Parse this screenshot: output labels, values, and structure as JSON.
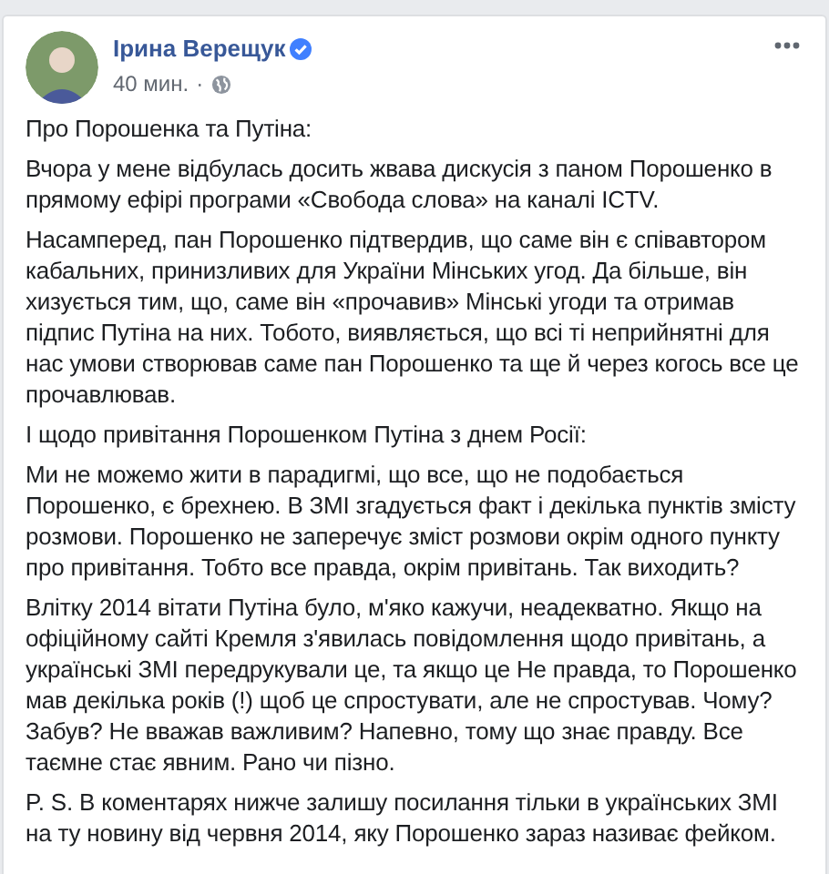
{
  "post": {
    "author": "Ірина Верещук",
    "verified": true,
    "time": "40 мин.",
    "separator": "·",
    "paragraphs": [
      "Про Порошенка та Путіна:",
      "Вчора у мене відбулась досить жвава дискусія з паном Порошенко в прямому ефірі програми «Свобода слова» на каналі ICTV.",
      "Насамперед, пан Порошенко підтвердив, що саме він є співавтором кабальних, принизливих для України Мінських угод. Да більше, він хизується тим, що, саме він «прочавив» Мінські угоди та отримав підпис Путіна на них. Тобото, виявляється, що всі ті неприйнятні для нас умови створював саме пан Порошенко та ще й через когось все це прочавлював.",
      "І щодо привітання Порошенком Путіна з днем Росії:",
      "Ми не можемо жити в парадигмі, що все, що не подобається Порошенко, є брехнею. В ЗМІ згадується факт і декілька пунктів змісту розмови. Порошенко не заперечує зміст розмови окрім одного пункту про привітання. Тобто все правда, окрім привітань. Так виходить?",
      "Влітку 2014 вітати Путіна було, м'яко кажучи, неадекватно. Якщо на офіційному сайті Кремля з'явилась повідомлення щодо привітань, а українські ЗМІ передрукували це, та якщо це Не правда, то Порошенко мав декілька років (!) щоб це спростувати, але не спростував. Чому? Забув? Не вважав важливим? Напевно, тому що знає правду. Все таємне стає явним. Рано чи пізно.",
      "P. S. В коментарях нижче залишу посилання тільки в українських ЗМІ на ту новину від червня 2014, яку Порошенко зараз називає фейком."
    ]
  }
}
